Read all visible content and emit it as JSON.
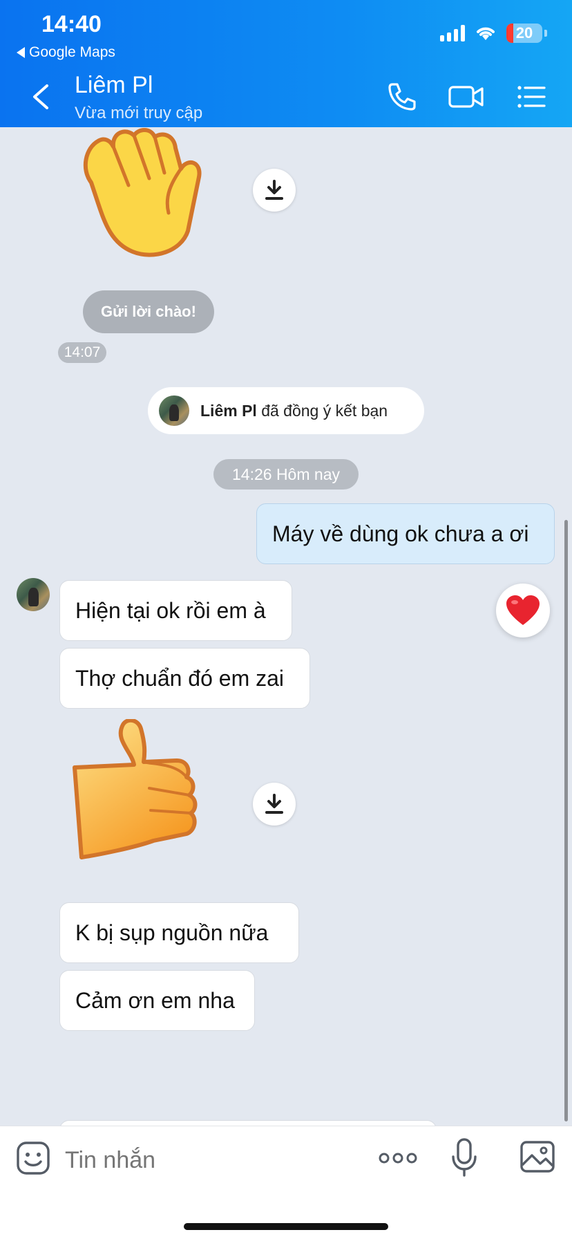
{
  "status_bar": {
    "time": "14:40",
    "back_app": "Google Maps",
    "battery": "20",
    "battery_level": 0.2
  },
  "header": {
    "contact_name": "Liêm Pl",
    "contact_status": "Vừa mới truy cập",
    "icons": [
      "back-chevron-icon",
      "phone-icon",
      "video-call-icon",
      "list-menu-icon"
    ]
  },
  "chat": {
    "greeting_sticker": "waving-hand",
    "greeting_button": "Gửi lời chào!",
    "greeting_time": "14:07",
    "friend_note": {
      "name": "Liêm Pl",
      "text": "đã đồng ý kết bạn"
    },
    "date_separator": "14:26 Hôm nay",
    "messages": [
      {
        "from": "me",
        "text": "Máy về dùng ok chưa a ơi"
      },
      {
        "from": "them",
        "text": "Hiện tại ok rồi em à",
        "reaction": "heart"
      },
      {
        "from": "them",
        "text": "Thợ chuẩn đó em zai"
      },
      {
        "from": "them",
        "sticker": "thumbs-up"
      },
      {
        "from": "them",
        "text": "K bị sụp nguồn nữa"
      },
      {
        "from": "them",
        "text": "Cảm ơn em nha"
      }
    ]
  },
  "composer": {
    "placeholder": "Tin nhắn"
  },
  "colors": {
    "header_start": "#0a73f0",
    "header_end": "#15a6f4",
    "chat_bg": "#e3e8f0",
    "my_bubble": "#d8ecfb"
  }
}
